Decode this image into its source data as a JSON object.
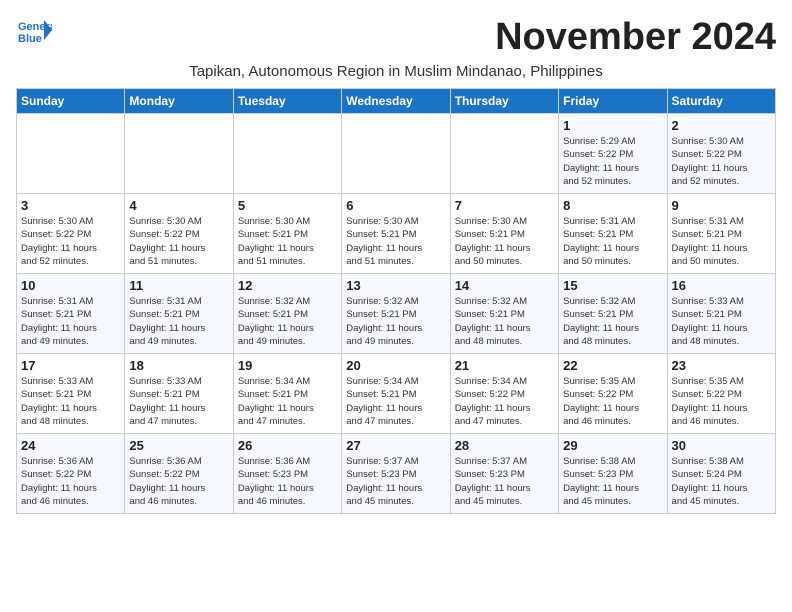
{
  "header": {
    "logo_line1": "General",
    "logo_line2": "Blue",
    "month_title": "November 2024",
    "subtitle": "Tapikan, Autonomous Region in Muslim Mindanao, Philippines"
  },
  "weekdays": [
    "Sunday",
    "Monday",
    "Tuesday",
    "Wednesday",
    "Thursday",
    "Friday",
    "Saturday"
  ],
  "weeks": [
    [
      {
        "day": "",
        "detail": ""
      },
      {
        "day": "",
        "detail": ""
      },
      {
        "day": "",
        "detail": ""
      },
      {
        "day": "",
        "detail": ""
      },
      {
        "day": "",
        "detail": ""
      },
      {
        "day": "1",
        "detail": "Sunrise: 5:29 AM\nSunset: 5:22 PM\nDaylight: 11 hours\nand 52 minutes."
      },
      {
        "day": "2",
        "detail": "Sunrise: 5:30 AM\nSunset: 5:22 PM\nDaylight: 11 hours\nand 52 minutes."
      }
    ],
    [
      {
        "day": "3",
        "detail": "Sunrise: 5:30 AM\nSunset: 5:22 PM\nDaylight: 11 hours\nand 52 minutes."
      },
      {
        "day": "4",
        "detail": "Sunrise: 5:30 AM\nSunset: 5:22 PM\nDaylight: 11 hours\nand 51 minutes."
      },
      {
        "day": "5",
        "detail": "Sunrise: 5:30 AM\nSunset: 5:21 PM\nDaylight: 11 hours\nand 51 minutes."
      },
      {
        "day": "6",
        "detail": "Sunrise: 5:30 AM\nSunset: 5:21 PM\nDaylight: 11 hours\nand 51 minutes."
      },
      {
        "day": "7",
        "detail": "Sunrise: 5:30 AM\nSunset: 5:21 PM\nDaylight: 11 hours\nand 50 minutes."
      },
      {
        "day": "8",
        "detail": "Sunrise: 5:31 AM\nSunset: 5:21 PM\nDaylight: 11 hours\nand 50 minutes."
      },
      {
        "day": "9",
        "detail": "Sunrise: 5:31 AM\nSunset: 5:21 PM\nDaylight: 11 hours\nand 50 minutes."
      }
    ],
    [
      {
        "day": "10",
        "detail": "Sunrise: 5:31 AM\nSunset: 5:21 PM\nDaylight: 11 hours\nand 49 minutes."
      },
      {
        "day": "11",
        "detail": "Sunrise: 5:31 AM\nSunset: 5:21 PM\nDaylight: 11 hours\nand 49 minutes."
      },
      {
        "day": "12",
        "detail": "Sunrise: 5:32 AM\nSunset: 5:21 PM\nDaylight: 11 hours\nand 49 minutes."
      },
      {
        "day": "13",
        "detail": "Sunrise: 5:32 AM\nSunset: 5:21 PM\nDaylight: 11 hours\nand 49 minutes."
      },
      {
        "day": "14",
        "detail": "Sunrise: 5:32 AM\nSunset: 5:21 PM\nDaylight: 11 hours\nand 48 minutes."
      },
      {
        "day": "15",
        "detail": "Sunrise: 5:32 AM\nSunset: 5:21 PM\nDaylight: 11 hours\nand 48 minutes."
      },
      {
        "day": "16",
        "detail": "Sunrise: 5:33 AM\nSunset: 5:21 PM\nDaylight: 11 hours\nand 48 minutes."
      }
    ],
    [
      {
        "day": "17",
        "detail": "Sunrise: 5:33 AM\nSunset: 5:21 PM\nDaylight: 11 hours\nand 48 minutes."
      },
      {
        "day": "18",
        "detail": "Sunrise: 5:33 AM\nSunset: 5:21 PM\nDaylight: 11 hours\nand 47 minutes."
      },
      {
        "day": "19",
        "detail": "Sunrise: 5:34 AM\nSunset: 5:21 PM\nDaylight: 11 hours\nand 47 minutes."
      },
      {
        "day": "20",
        "detail": "Sunrise: 5:34 AM\nSunset: 5:21 PM\nDaylight: 11 hours\nand 47 minutes."
      },
      {
        "day": "21",
        "detail": "Sunrise: 5:34 AM\nSunset: 5:22 PM\nDaylight: 11 hours\nand 47 minutes."
      },
      {
        "day": "22",
        "detail": "Sunrise: 5:35 AM\nSunset: 5:22 PM\nDaylight: 11 hours\nand 46 minutes."
      },
      {
        "day": "23",
        "detail": "Sunrise: 5:35 AM\nSunset: 5:22 PM\nDaylight: 11 hours\nand 46 minutes."
      }
    ],
    [
      {
        "day": "24",
        "detail": "Sunrise: 5:36 AM\nSunset: 5:22 PM\nDaylight: 11 hours\nand 46 minutes."
      },
      {
        "day": "25",
        "detail": "Sunrise: 5:36 AM\nSunset: 5:22 PM\nDaylight: 11 hours\nand 46 minutes."
      },
      {
        "day": "26",
        "detail": "Sunrise: 5:36 AM\nSunset: 5:23 PM\nDaylight: 11 hours\nand 46 minutes."
      },
      {
        "day": "27",
        "detail": "Sunrise: 5:37 AM\nSunset: 5:23 PM\nDaylight: 11 hours\nand 45 minutes."
      },
      {
        "day": "28",
        "detail": "Sunrise: 5:37 AM\nSunset: 5:23 PM\nDaylight: 11 hours\nand 45 minutes."
      },
      {
        "day": "29",
        "detail": "Sunrise: 5:38 AM\nSunset: 5:23 PM\nDaylight: 11 hours\nand 45 minutes."
      },
      {
        "day": "30",
        "detail": "Sunrise: 5:38 AM\nSunset: 5:24 PM\nDaylight: 11 hours\nand 45 minutes."
      }
    ]
  ]
}
